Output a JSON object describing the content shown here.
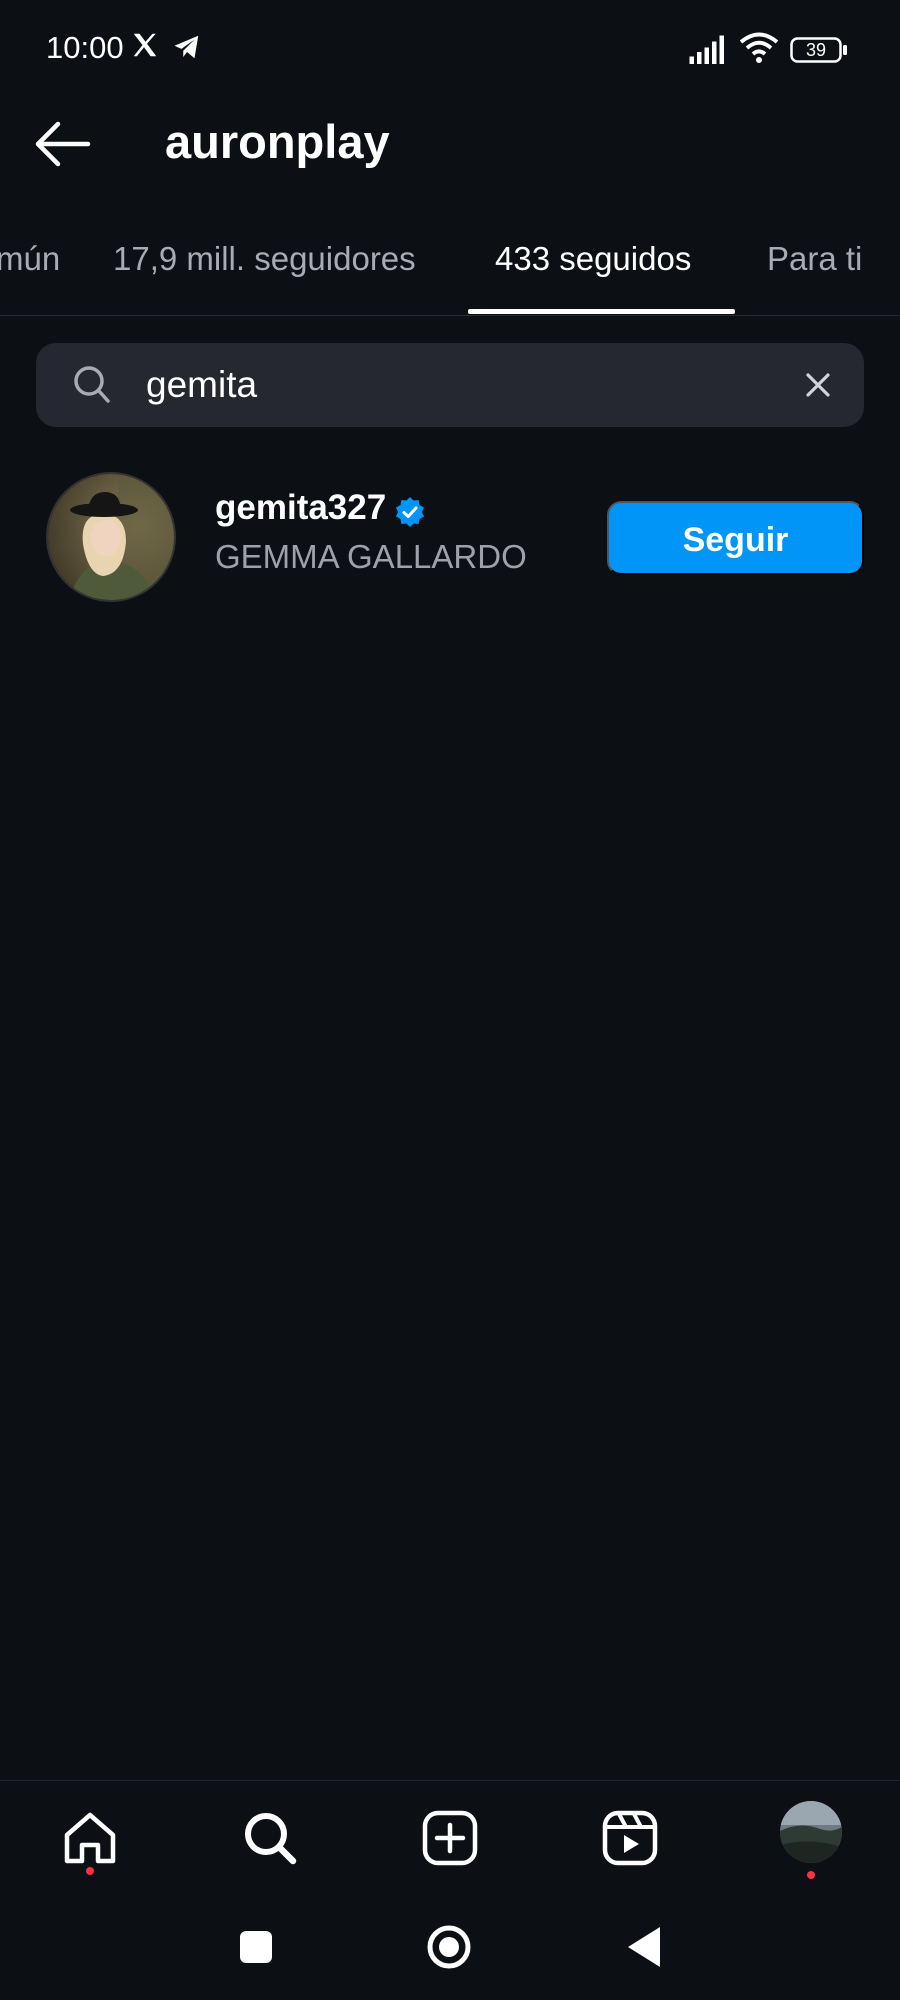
{
  "status_bar": {
    "time": "10:00",
    "battery": "39",
    "icons": [
      "x-icon",
      "telegram-icon",
      "signal-icon",
      "wifi-icon",
      "battery-icon"
    ]
  },
  "header": {
    "title": "auronplay",
    "back_icon": "arrow-left-icon"
  },
  "tabs": [
    {
      "label": "mún",
      "active": false
    },
    {
      "label": "17,9 mill. seguidores",
      "active": false
    },
    {
      "label": "433 seguidos",
      "active": true
    },
    {
      "label": "Para ti",
      "active": false
    }
  ],
  "search": {
    "value": "gemita",
    "icon": "search-icon",
    "clear_icon": "close-icon"
  },
  "results": [
    {
      "username": "gemita327",
      "full_name": "GEMMA GALLARDO",
      "verified": true,
      "button_label": "Seguir"
    }
  ],
  "bottom_nav": {
    "items": [
      "home-icon",
      "search-icon",
      "create-icon",
      "reels-icon",
      "profile-avatar"
    ]
  },
  "system_nav": {
    "items": [
      "recents-icon",
      "home-circle-icon",
      "back-triangle-icon"
    ]
  },
  "colors": {
    "background": "#0c0f14",
    "accent": "#0095f6",
    "search_bg": "#252830",
    "notification_dot": "#ff3040"
  }
}
